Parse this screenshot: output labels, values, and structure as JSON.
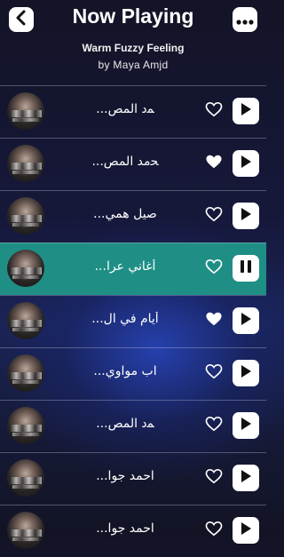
{
  "header": {
    "title": "Now Playing",
    "song_title": "Warm Fuzzy Feeling",
    "artist": "by Maya Amjd"
  },
  "icons": {
    "back": "chevron-left-icon",
    "menu": "more-horizontal-icon",
    "favorite_outline": "heart-outline-icon",
    "favorite_filled": "heart-filled-icon",
    "play": "play-icon",
    "pause": "pause-icon"
  },
  "colors": {
    "accent": "#1f8f86",
    "icon_dark": "#111111"
  },
  "tracks": [
    {
      "name": "ﻤد المص...",
      "favorite": false,
      "state": "play"
    },
    {
      "name": "ﺤمد المص...",
      "favorite": true,
      "state": "play"
    },
    {
      "name": "صيل همي...",
      "favorite": false,
      "state": "play"
    },
    {
      "name": "أغاني عرا...",
      "favorite": false,
      "state": "pause"
    },
    {
      "name": "أيام في ال...",
      "favorite": true,
      "state": "play"
    },
    {
      "name": "اب مواوي...",
      "favorite": false,
      "state": "play"
    },
    {
      "name": "ﻤد المص...",
      "favorite": false,
      "state": "play"
    },
    {
      "name": "احمد جوا...",
      "favorite": false,
      "state": "play"
    },
    {
      "name": "احمد جوا...",
      "favorite": false,
      "state": "play"
    }
  ]
}
